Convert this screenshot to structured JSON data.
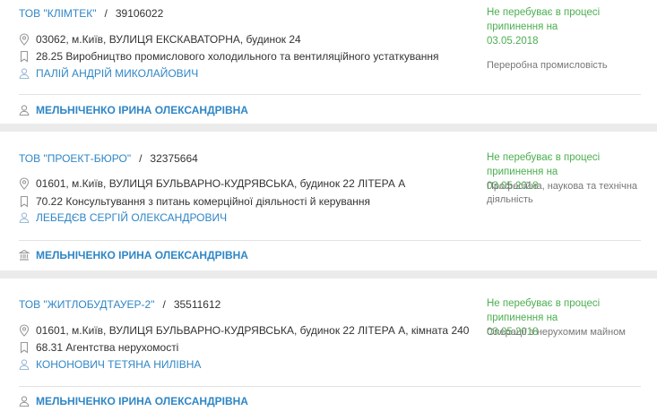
{
  "companies": [
    {
      "name": "ТОВ \"КЛІМТЕК\"",
      "code": "39106022",
      "status": "Не перебуває в процесі припинення на 03.05.2018",
      "address": "03062, м.Київ, ВУЛИЦЯ ЕКСКАВАТОРНА, будинок 24",
      "activity": "28.25 Виробництво промислового холодильного та вентиляційного устаткування",
      "director": "ПАЛІЙ АНДРІЙ МИКОЛАЙОВИЧ",
      "industry": "Переробна промисловість",
      "owner": "МЕЛЬНІЧЕНКО ІРИНА ОЛЕКСАНДРІВНА",
      "owner_icon": "person-icon"
    },
    {
      "name": "ТОВ \"ПРОЕКТ-БЮРО\"",
      "code": "32375664",
      "status": "Не перебуває в процесі припинення на 03.05.2018",
      "address": "01601, м.Київ, ВУЛИЦЯ БУЛЬВАРНО-КУДРЯВСЬКА, будинок 22 ЛІТЕРА А",
      "activity": "70.22 Консультування з питань комерційної діяльності й керування",
      "director": "ЛЕБЕДЄВ СЕРГІЙ ОЛЕКСАНДРОВИЧ",
      "industry": "Професійна, наукова та технічна діяльність",
      "owner": "МЕЛЬНІЧЕНКО ІРИНА ОЛЕКСАНДРІВНА",
      "owner_icon": "bank-icon"
    },
    {
      "name": "ТОВ \"ЖИТЛОБУДТАУЕР-2\"",
      "code": "35511612",
      "status": "Не перебуває в процесі припинення на 03.05.2018",
      "address": "01601, м.Київ, ВУЛИЦЯ БУЛЬВАРНО-КУДРЯВСЬКА, будинок 22 ЛІТЕРА А, кімната 240",
      "activity": "68.31 Агентства нерухомості",
      "director": "КОНОНОВИЧ ТЕТЯНА НИЛІВНА",
      "industry": "Операції з нерухомим майном",
      "owner": "МЕЛЬНІЧЕНКО ІРИНА ОЛЕКСАНДРІВНА",
      "owner_icon": "person-icon"
    }
  ],
  "colors": {
    "link": "#2f86c6",
    "status": "#4caf50",
    "muted": "#777777",
    "separator": "#ebebeb"
  }
}
